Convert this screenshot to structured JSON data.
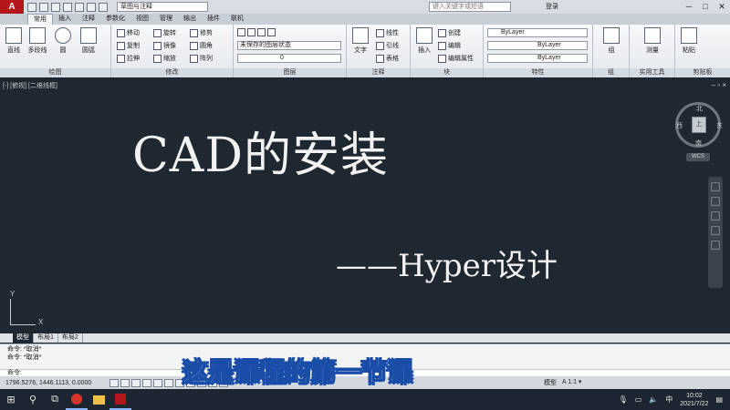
{
  "titlebar": {
    "app_logo": "A",
    "workspace": "草图与注释",
    "search_placeholder": "键入关键字或短语",
    "signin": "登录",
    "min": "─",
    "max": "□",
    "close": "✕"
  },
  "tabs": [
    "常用",
    "插入",
    "注释",
    "参数化",
    "视图",
    "管理",
    "输出",
    "插件",
    "联机"
  ],
  "ribbon": {
    "draw": {
      "line": "直线",
      "polyline": "多段线",
      "circle": "圆",
      "arc": "圆弧",
      "title": "绘图"
    },
    "modify": {
      "move": "移动",
      "rotate": "旋转",
      "trim": "修剪",
      "copy": "复制",
      "mirror": "镜像",
      "fillet": "圆角",
      "stretch": "拉伸",
      "scale": "缩放",
      "array": "阵列",
      "title": "修改"
    },
    "layers": {
      "state": "未保存的图层状态",
      "current": "0",
      "title": "图层"
    },
    "annotation": {
      "text": "文字",
      "linear": "线性",
      "leader": "引线",
      "table": "表格",
      "title": "注释"
    },
    "block": {
      "insert": "插入",
      "create": "创建",
      "edit": "编辑",
      "edit_attr": "编辑属性",
      "title": "块"
    },
    "properties": {
      "color": "ByLayer",
      "linetype": "ByLayer",
      "lineweight": "ByLayer",
      "title": "特性"
    },
    "group": {
      "group": "组",
      "title": "组"
    },
    "utilities": {
      "measure": "测量",
      "title": "实用工具"
    },
    "clipboard": {
      "paste": "粘贴",
      "title": "剪贴板"
    }
  },
  "canvas": {
    "viewport_label": "[-] [俯视] [二维线框]",
    "viewport_ctrls": "– ▫ ×",
    "title": "CAD的安装",
    "subtitle": "——Hyper设计",
    "viewcube": {
      "top": "上",
      "north": "北",
      "south": "南",
      "east": "东",
      "west": "西"
    },
    "wcs": "WCS",
    "ucs_y": "Y",
    "ucs_x": "X"
  },
  "layout_tabs": [
    "模型",
    "布局1",
    "布局2"
  ],
  "command": {
    "history": [
      "命令: *取消*",
      "命令: *取消*"
    ],
    "prompt": "命令:"
  },
  "statusbar": {
    "coords": "1796.5276, 1446.1113, 0.0000",
    "model": "模型",
    "scale": "A 1:1 ▾"
  },
  "caption": "这是课程的第一节课",
  "taskbar": {
    "start": "⊞",
    "search": "⚲",
    "taskview": "⧉",
    "ime": "中",
    "time": "10:02",
    "date": "2021/7/22"
  },
  "colors": {
    "canvas": "#1f2730",
    "accent": "#b3171c",
    "caption_outline": "#1a4da8"
  }
}
